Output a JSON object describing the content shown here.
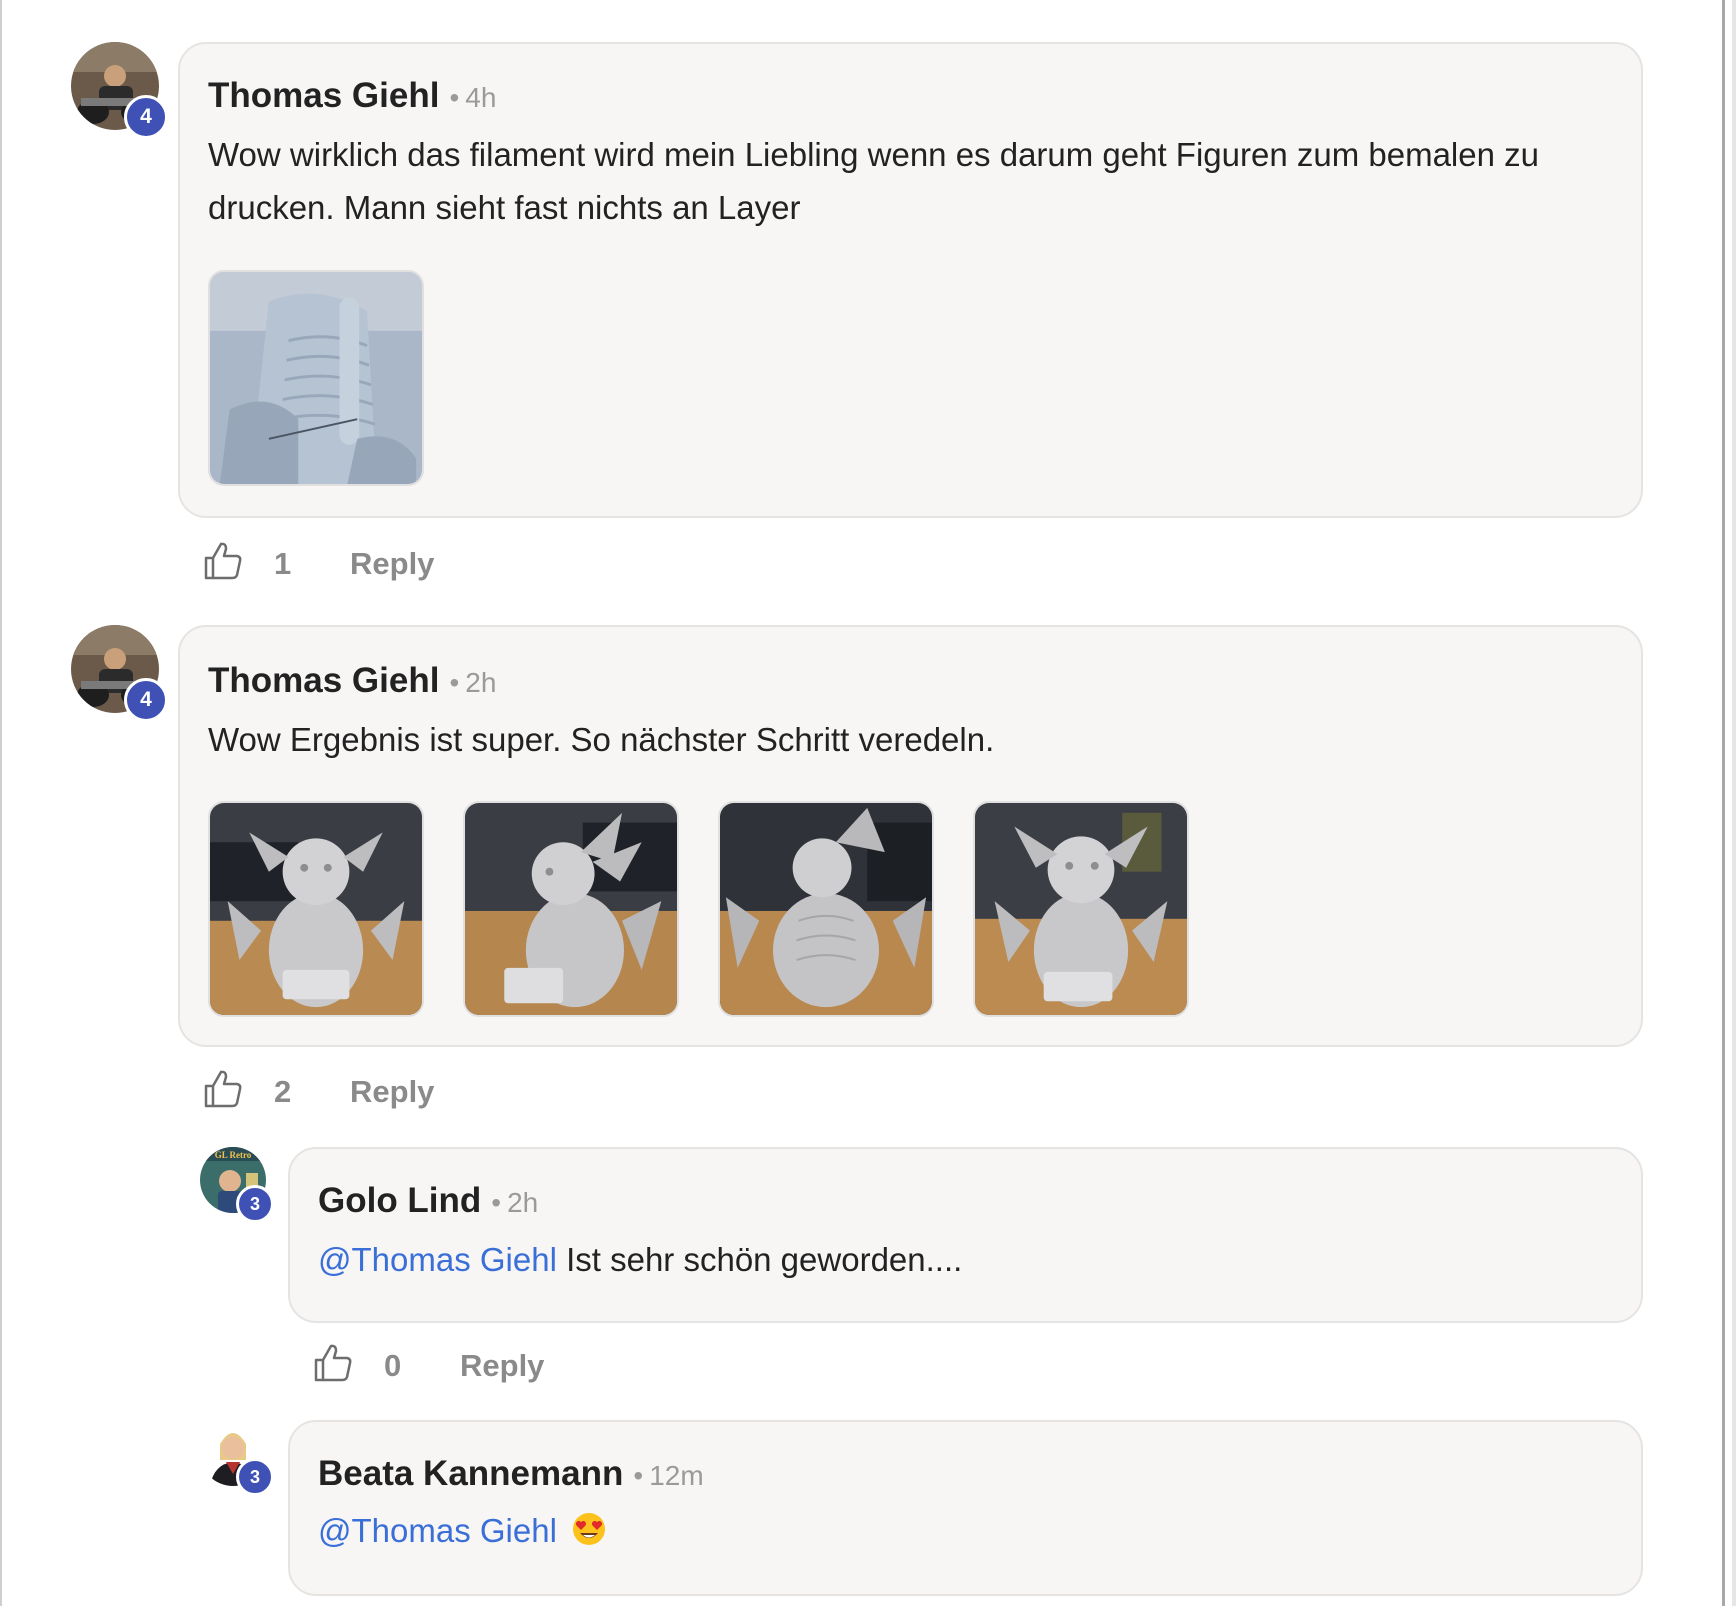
{
  "comments": [
    {
      "author": "Thomas Giehl",
      "time": "4h",
      "separator": "•",
      "level": "4",
      "text": "Wow wirklich das filament wird mein Liebling wenn es darum geht Figuren zum bemalen zu drucken. Mann sieht fast nichts an Layer",
      "likes": "1",
      "reply_label": "Reply"
    },
    {
      "author": "Thomas Giehl",
      "time": "2h",
      "separator": "•",
      "level": "4",
      "text": "Wow Ergebnis ist super. So nächster Schritt veredeln.",
      "likes": "2",
      "reply_label": "Reply"
    }
  ],
  "replies": [
    {
      "author": "Golo Lind",
      "time": "2h",
      "separator": "•",
      "level": "3",
      "mention": "@Thomas Giehl",
      "text": " Ist sehr schön geworden....",
      "likes": "0",
      "reply_label": "Reply"
    },
    {
      "author": "Beata Kannemann",
      "time": "12m",
      "separator": "•",
      "level": "3",
      "mention": "@Thomas Giehl",
      "emoji": "heart-eyes-emoji"
    }
  ],
  "avatar_logo_text": "GL Retro",
  "colors": {
    "badge": "#3f51b5",
    "mention": "#3a6fd8",
    "bubble": "#f7f6f5"
  }
}
